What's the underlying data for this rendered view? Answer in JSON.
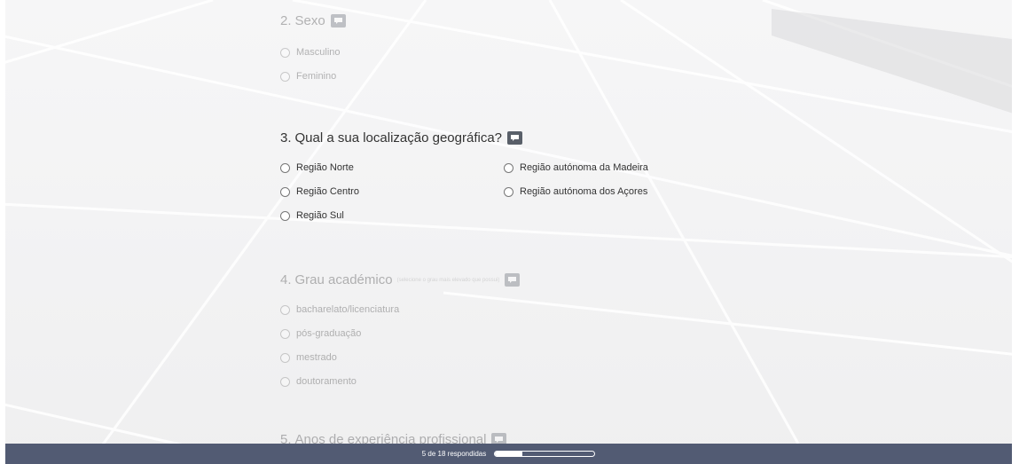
{
  "progress": {
    "label": "5 de 18 respondidas",
    "answered": 5,
    "total": 18
  },
  "questions": [
    {
      "number": "2.",
      "title": "Sexo",
      "options": [
        "Masculino",
        "Feminino"
      ]
    },
    {
      "number": "3.",
      "title": "Qual a sua localização geográfica?",
      "options_left": [
        "Região Norte",
        "Região Centro",
        "Região Sul"
      ],
      "options_right": [
        "Região autónoma da Madeira",
        "Região autónoma dos Açores"
      ]
    },
    {
      "number": "4.",
      "title": "Grau académico",
      "hint": "(selecione o grau mais elevado que possui)",
      "options": [
        "bacharelato/licenciatura",
        "pós-graduação",
        "mestrado",
        "doutoramento"
      ]
    },
    {
      "number": "5.",
      "title": "Anos de experiência profissional"
    }
  ],
  "icons": {
    "comment": "comment-icon",
    "radio": "radio-circle"
  },
  "colors": {
    "footer_bg": "#525b73",
    "icon_bg": "#595f69",
    "text": "#333333"
  }
}
